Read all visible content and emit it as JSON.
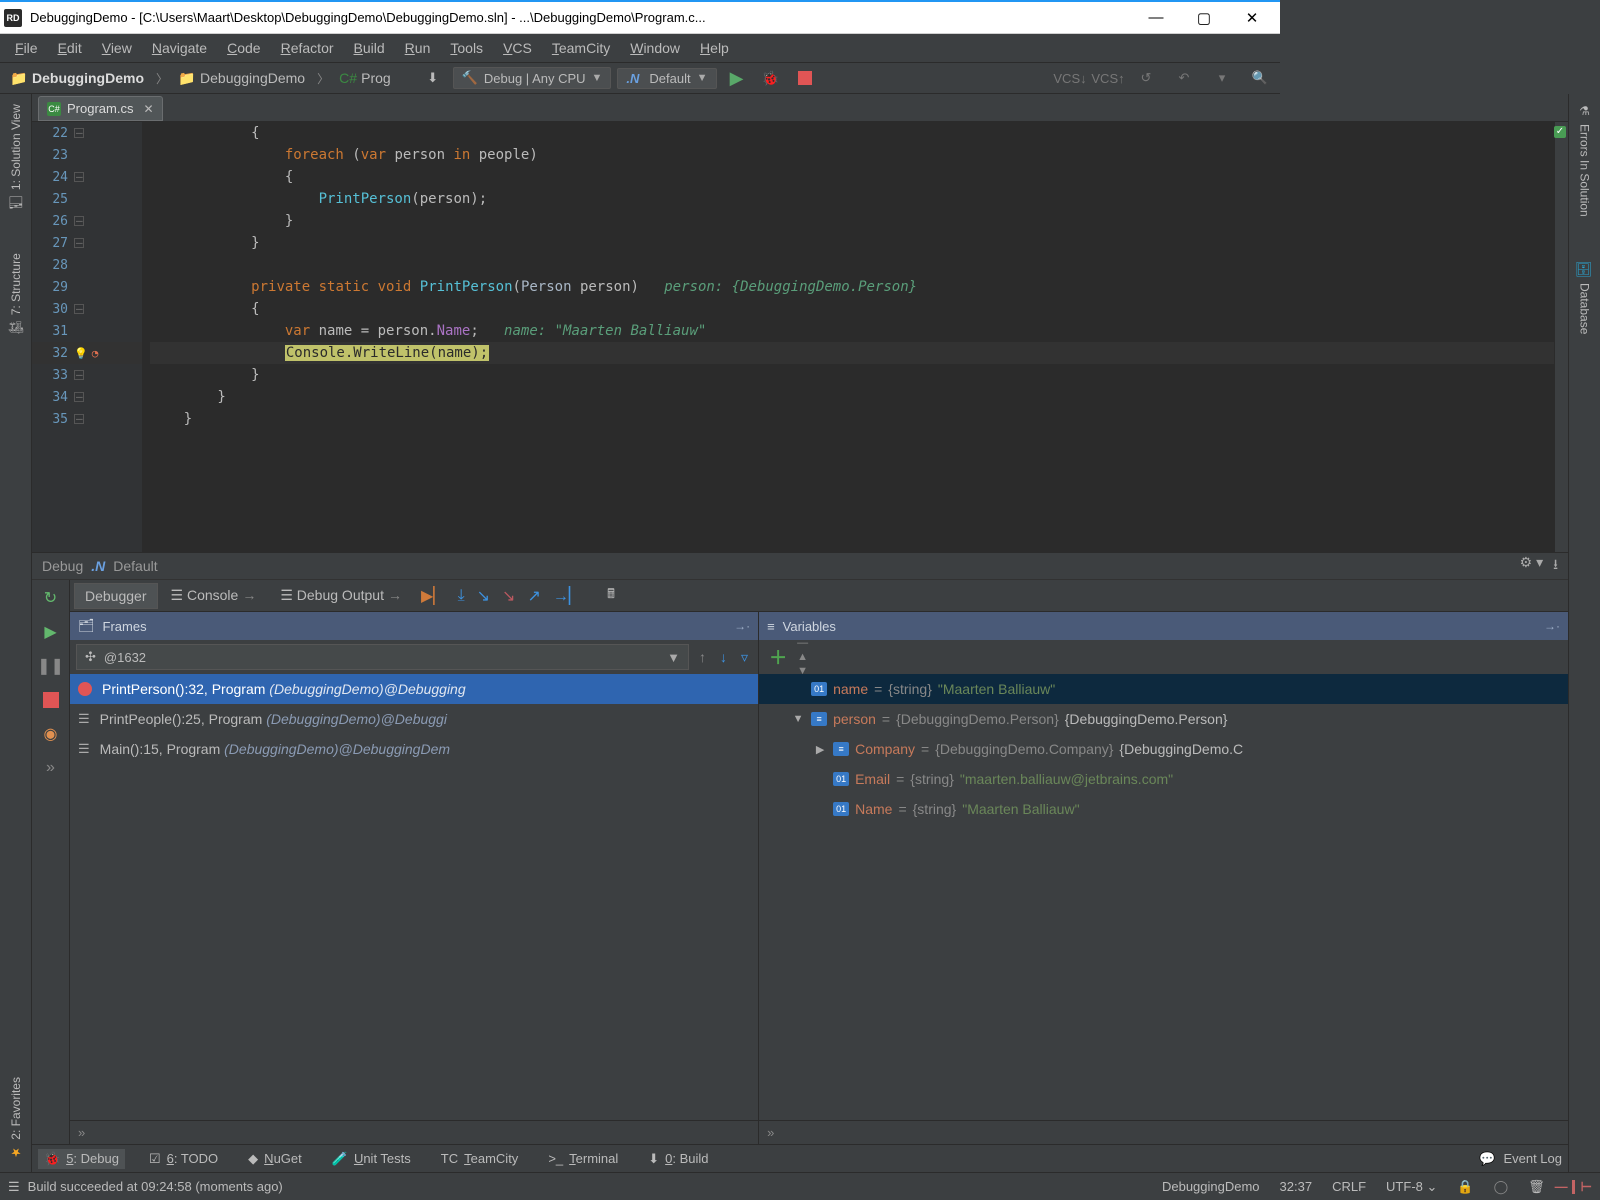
{
  "title": "DebuggingDemo - [C:\\Users\\Maart\\Desktop\\DebuggingDemo\\DebuggingDemo.sln] - ...\\DebuggingDemo\\Program.c...",
  "app_badge": "RD",
  "menu": {
    "items": [
      "File",
      "Edit",
      "View",
      "Navigate",
      "Code",
      "Refactor",
      "Build",
      "Run",
      "Tools",
      "VCS",
      "TeamCity",
      "Window",
      "Help"
    ]
  },
  "breadcrumb": {
    "project": "DebuggingDemo",
    "module": "DebuggingDemo",
    "file_short": "Prog"
  },
  "toolbar": {
    "config_label": "Debug | Any CPU",
    "run_target": "Default"
  },
  "editor_tab": {
    "filename": "Program.cs"
  },
  "code_lines": {
    "start": 22,
    "lines": [
      {
        "n": 22,
        "html": "            {"
      },
      {
        "n": 23,
        "html": "                <span class='kw'>foreach</span> (<span class='kw'>var</span> person <span class='kw'>in</span> people)"
      },
      {
        "n": 24,
        "html": "                {"
      },
      {
        "n": 25,
        "html": "                    <span class='mth'>PrintPerson</span>(person);"
      },
      {
        "n": 26,
        "html": "                }"
      },
      {
        "n": 27,
        "html": "            }"
      },
      {
        "n": 28,
        "html": ""
      },
      {
        "n": 29,
        "html": "            <span class='kw'>private</span> <span class='kw'>static</span> <span class='kw'>void</span> <span class='mth'>PrintPerson</span>(<span class='ty'>Person</span> person)   <span class='hint'>person: {DebuggingDemo.Person}</span>"
      },
      {
        "n": 30,
        "html": "            {"
      },
      {
        "n": 31,
        "html": "                <span class='kw'>var</span> name = person.<span class='prop'>Name</span>;   <span class='hint'>name: \"Maarten Balliauw\"</span>"
      },
      {
        "n": 32,
        "html": "                <span class='hl'>Console.WriteLine(name);</span>",
        "active": true
      },
      {
        "n": 33,
        "html": "            }"
      },
      {
        "n": 34,
        "html": "        }"
      },
      {
        "n": 35,
        "html": "    }"
      }
    ]
  },
  "side_tabs": {
    "left": [
      "1: Solution View",
      "7: Structure",
      "2: Favorites"
    ],
    "right": [
      "Errors In Solution",
      "Database"
    ]
  },
  "debug": {
    "title_prefix": "Debug",
    "title_config": "Default",
    "tabs": [
      "Debugger",
      "Console",
      "Debug Output"
    ],
    "thread": "@1632",
    "frames_head": "Frames",
    "vars_head": "Variables",
    "frames": [
      {
        "label": "PrintPerson():32, Program ",
        "italic": "(DebuggingDemo)@Debugging",
        "selected": true,
        "bp": true
      },
      {
        "label": "PrintPeople():25, Program ",
        "italic": "(DebuggingDemo)@Debuggi"
      },
      {
        "label": "Main():15, Program ",
        "italic": "(DebuggingDemo)@DebuggingDem"
      }
    ],
    "vars": [
      {
        "d": 1,
        "sel": true,
        "tw": "",
        "name": "name",
        "type": "{string}",
        "value": "\"Maarten Balliauw\"",
        "valkind": "str",
        "icon": "01"
      },
      {
        "d": 1,
        "tw": "▼",
        "name": "person",
        "type": "{DebuggingDemo.Person}",
        "value": "{DebuggingDemo.Person}",
        "valkind": "obj",
        "icon": "≡"
      },
      {
        "d": 2,
        "tw": "▶",
        "name": "Company",
        "type": "{DebuggingDemo.Company}",
        "value": "{DebuggingDemo.C",
        "valkind": "obj",
        "icon": "≡"
      },
      {
        "d": 2,
        "tw": "",
        "name": "Email",
        "type": "{string}",
        "value": "\"maarten.balliauw@jetbrains.com\"",
        "valkind": "str",
        "icon": "01"
      },
      {
        "d": 2,
        "tw": "",
        "name": "Name",
        "type": "{string}",
        "value": "\"Maarten Balliauw\"",
        "valkind": "str",
        "icon": "01"
      }
    ]
  },
  "bottom_tabs": {
    "items": [
      {
        "label": "5: Debug",
        "active": true
      },
      {
        "label": "6: TODO"
      },
      {
        "label": "NuGet"
      },
      {
        "label": "Unit Tests"
      },
      {
        "label": "TeamCity"
      },
      {
        "label": "Terminal"
      },
      {
        "label": "0: Build"
      }
    ],
    "event_log": "Event Log"
  },
  "statusbar": {
    "message": "Build succeeded at 09:24:58 (moments ago)",
    "context": "DebuggingDemo",
    "position": "32:37",
    "line_ending": "CRLF",
    "encoding": "UTF-8"
  }
}
